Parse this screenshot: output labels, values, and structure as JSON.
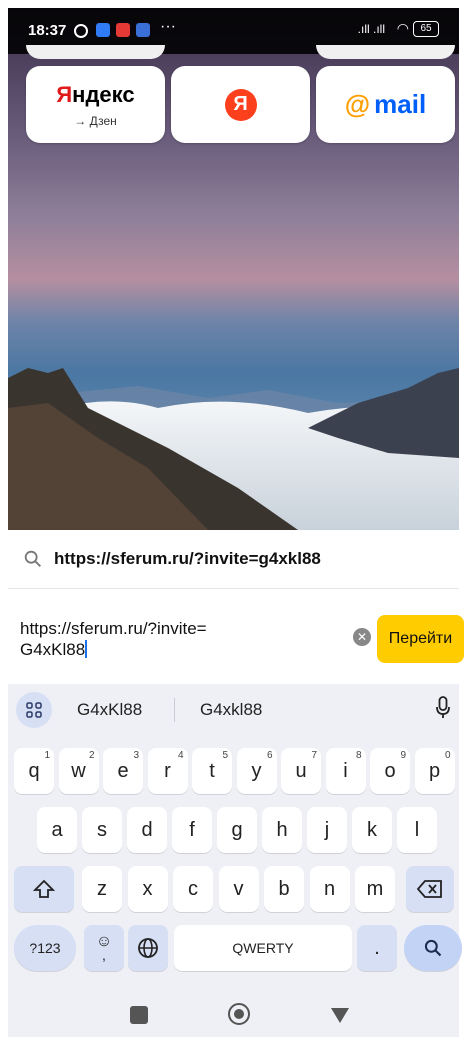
{
  "status_bar": {
    "time": "18:37",
    "signal_icons": ".ıll .ıll",
    "battery": "65"
  },
  "speed_dial": {
    "yandex_tile": {
      "name_first": "Я",
      "name_rest": "ндекс",
      "subtitle": "→ Дзен"
    },
    "ya_tile": {
      "letter": "Я"
    },
    "mail_tile": {
      "at": "@",
      "label": "mail"
    }
  },
  "suggestion": {
    "icon": "search-icon",
    "text": "https://sferum.ru/?invite=g4xkl88"
  },
  "address_bar": {
    "text_line1": "https://sferum.ru/?invite=",
    "text_line2": "G4xKl88",
    "go_button": "Перейти"
  },
  "keyboard": {
    "suggestions": [
      "G4xKl88",
      "G4xkl88"
    ],
    "row1": [
      {
        "k": "q",
        "h": "1"
      },
      {
        "k": "w",
        "h": "2"
      },
      {
        "k": "e",
        "h": "3"
      },
      {
        "k": "r",
        "h": "4"
      },
      {
        "k": "t",
        "h": "5"
      },
      {
        "k": "y",
        "h": "6"
      },
      {
        "k": "u",
        "h": "7"
      },
      {
        "k": "i",
        "h": "8"
      },
      {
        "k": "o",
        "h": "9"
      },
      {
        "k": "p",
        "h": "0"
      }
    ],
    "row2": [
      "a",
      "s",
      "d",
      "f",
      "g",
      "h",
      "j",
      "k",
      "l"
    ],
    "row3": [
      "z",
      "x",
      "c",
      "v",
      "b",
      "n",
      "m"
    ],
    "symbols_key": "?123",
    "emoji_key_sub": ",",
    "space_label": "QWERTY",
    "period_key": "."
  }
}
